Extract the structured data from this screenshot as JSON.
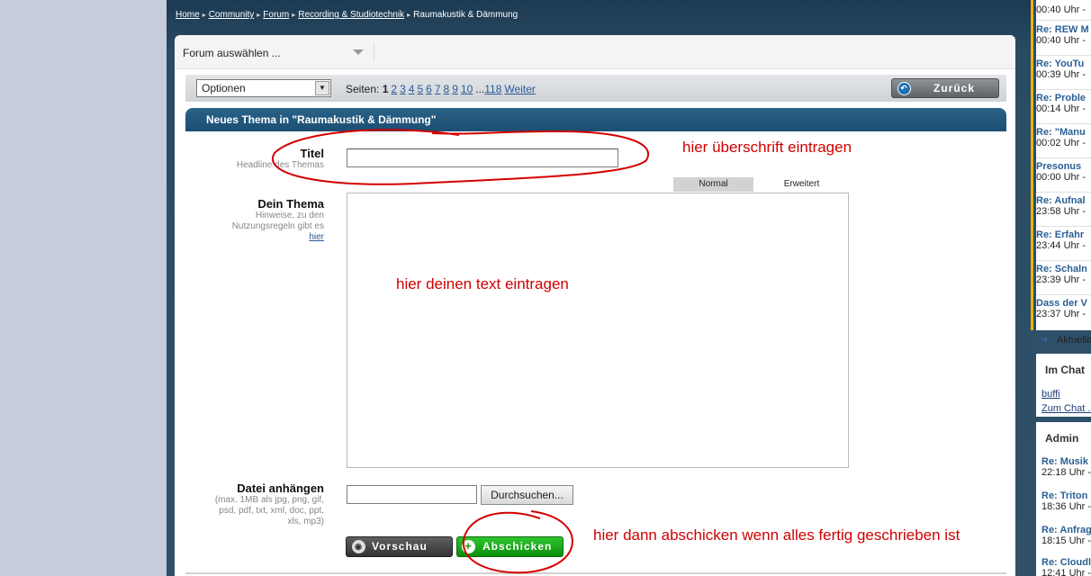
{
  "breadcrumb": [
    "Home",
    "Community",
    "Forum",
    "Recording & Studiotechnik",
    "Raumakustik & Dämmung"
  ],
  "forum_select": {
    "label": "Forum auswählen ..."
  },
  "toolbar": {
    "options_label": "Optionen",
    "pages_label": "Seiten:",
    "current_page": "1",
    "pages": [
      "2",
      "3",
      "4",
      "5",
      "6",
      "7",
      "8",
      "9",
      "10"
    ],
    "ellipsis": "...",
    "last_page": "118",
    "next_label": "Weiter",
    "back_label": "Zurück"
  },
  "section": {
    "heading": "Neues Thema in \"Raumakustik & Dämmung\""
  },
  "form": {
    "title_label": "Titel",
    "title_sub": "Headline des Themas",
    "topic_label": "Dein Thema",
    "topic_sub_1": "Hinweise, zu den",
    "topic_sub_2": "Nutzungsregeln gibt es",
    "topic_link": "hier",
    "tab_normal": "Normal",
    "tab_extended": "Erweitert",
    "file_label": "Datei anhängen",
    "file_sub_1": "(max. 1MB als jpg, png, gif,",
    "file_sub_2": "psd, pdf, txt, xml, doc, ppt,",
    "file_sub_3": "xls, mp3)",
    "browse_label": "Durchsuchen...",
    "preview_label": "Vorschau",
    "submit_label": "Abschicken"
  },
  "annotations": {
    "title_note": "hier überschrift eintragen",
    "text_note": "hier deinen text eintragen",
    "submit_note": "hier dann abschicken wenn alles fertig geschrieben ist",
    "color": "#d00000"
  },
  "sidebar": {
    "feed": [
      {
        "title": "",
        "time": "00:40 Uhr -"
      },
      {
        "title": "Re: REW M",
        "time": "00:40 Uhr -"
      },
      {
        "title": "Re: YouTu",
        "time": "00:39 Uhr -"
      },
      {
        "title": "Re: Proble",
        "time": "00:14 Uhr -"
      },
      {
        "title": "Re: \"Manu",
        "time": "00:02 Uhr -"
      },
      {
        "title": "Presonus",
        "time": "00:00 Uhr -"
      },
      {
        "title": "Re: Aufnal",
        "time": "23:58 Uhr -"
      },
      {
        "title": "Re: Erfahr",
        "time": "23:44 Uhr -"
      },
      {
        "title": "Re: Schaln",
        "time": "23:39 Uhr -"
      },
      {
        "title": "Dass der V",
        "time": "23:37 Uhr -"
      }
    ],
    "aktuell_label": "Aktuelle",
    "chat": {
      "heading": "Im Chat",
      "user": "buffi",
      "link": "Zum Chat ..."
    },
    "admin": {
      "heading": "Admin",
      "items": [
        {
          "title": "Re: Musik",
          "time": "22:18 Uhr -"
        },
        {
          "title": "Re: Triton",
          "time": "18:36 Uhr -"
        },
        {
          "title": "Re: Anfrag",
          "time": "18:15 Uhr -"
        },
        {
          "title": "Re: Cloudl",
          "time": "12:41 Uhr -"
        }
      ]
    }
  },
  "colors": {
    "header_dark": "#1c3a52",
    "section_blue": "#1b4e72",
    "submit_green": "#119a11",
    "link_blue": "#2a5a9a"
  }
}
